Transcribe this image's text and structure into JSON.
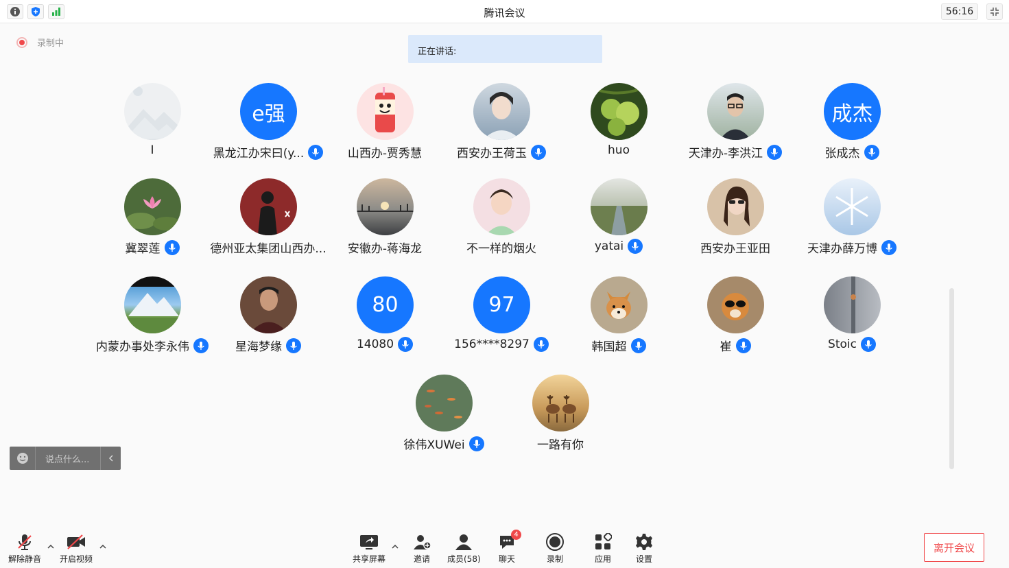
{
  "title_bar": {
    "title": "腾讯会议",
    "timer": "56:16"
  },
  "recording": {
    "label": "录制中"
  },
  "speaking": {
    "label": "正在讲话:"
  },
  "participants": [
    {
      "name": "I",
      "avatar_text": "",
      "mic": false
    },
    {
      "name": "黑龙江办宋曰(y...",
      "avatar_text": "e强",
      "mic": true
    },
    {
      "name": "山西办-贾秀慧",
      "avatar_text": "",
      "mic": false
    },
    {
      "name": "西安办王荷玉",
      "avatar_text": "",
      "mic": true
    },
    {
      "name": "huo",
      "avatar_text": "",
      "mic": false
    },
    {
      "name": "天津办-李洪江",
      "avatar_text": "",
      "mic": true
    },
    {
      "name": "张成杰",
      "avatar_text": "成杰",
      "mic": true
    },
    {
      "name": "冀翠莲",
      "avatar_text": "",
      "mic": true
    },
    {
      "name": "德州亚太集团山西办...",
      "avatar_text": "",
      "mic": false
    },
    {
      "name": "安徽办-蒋海龙",
      "avatar_text": "",
      "mic": false
    },
    {
      "name": "不一样的烟火",
      "avatar_text": "",
      "mic": false
    },
    {
      "name": "yatai",
      "avatar_text": "",
      "mic": true
    },
    {
      "name": "西安办王亚田",
      "avatar_text": "",
      "mic": false
    },
    {
      "name": "天津办薛万博",
      "avatar_text": "",
      "mic": true
    },
    {
      "name": "内蒙办事处李永伟",
      "avatar_text": "",
      "mic": true
    },
    {
      "name": "星海梦缘",
      "avatar_text": "",
      "mic": true
    },
    {
      "name": "14080",
      "avatar_text": "80",
      "mic": true
    },
    {
      "name": "156****8297",
      "avatar_text": "97",
      "mic": true
    },
    {
      "name": "韩国超",
      "avatar_text": "",
      "mic": true
    },
    {
      "name": "崔",
      "avatar_text": "",
      "mic": true
    },
    {
      "name": "Stoic",
      "avatar_text": "",
      "mic": true
    },
    {
      "name": "徐伟XUWei",
      "avatar_text": "",
      "mic": true
    },
    {
      "name": "一路有你",
      "avatar_text": "",
      "mic": false
    }
  ],
  "chat": {
    "placeholder": "说点什么..."
  },
  "toolbar": {
    "unmute": "解除静音",
    "video": "开启视频",
    "share": "共享屏幕",
    "invite": "邀请",
    "members": "成员(58)",
    "chat": "聊天",
    "chat_badge": "4",
    "record": "录制",
    "apps": "应用",
    "settings": "设置",
    "leave": "离开会议"
  },
  "colors": {
    "accent": "#1677ff",
    "danger": "#f0484a",
    "speaking_bg": "#dbe9fb"
  }
}
